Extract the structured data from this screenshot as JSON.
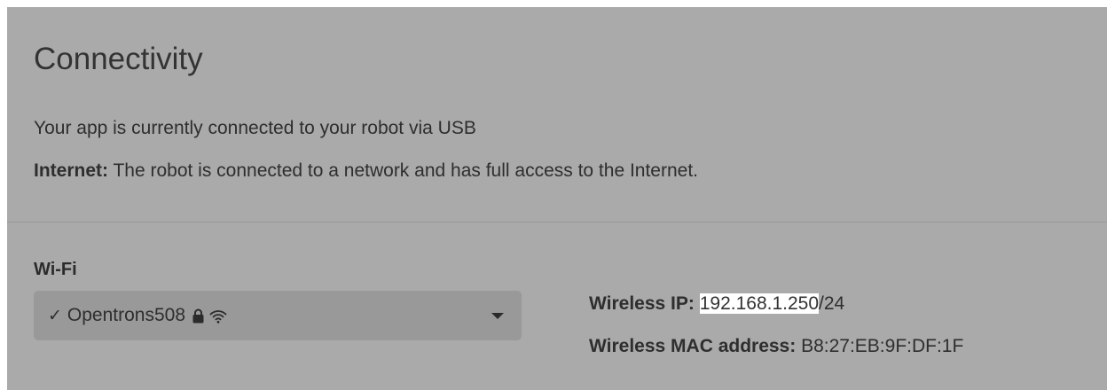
{
  "connectivity": {
    "title": "Connectivity",
    "status_text": "Your app is currently connected to your robot via USB",
    "internet_label": "Internet:",
    "internet_text": " The robot is connected to a network and has full access to the Internet."
  },
  "wifi": {
    "label": "Wi-Fi",
    "selected_check": "✓",
    "selected_network": "Opentrons508",
    "secured_icon": "lock-icon",
    "signal_icon": "wifi-signal-icon"
  },
  "network_info": {
    "ip_label": "Wireless IP:",
    "ip_value": "192.168.1.250",
    "ip_suffix": "/24",
    "mac_label": "Wireless MAC address:",
    "mac_value": "B8:27:EB:9F:DF:1F"
  },
  "colors": {
    "panel_background": "#aaaaaa",
    "dropdown_background": "#999999",
    "ip_highlight": "#ffffff"
  }
}
